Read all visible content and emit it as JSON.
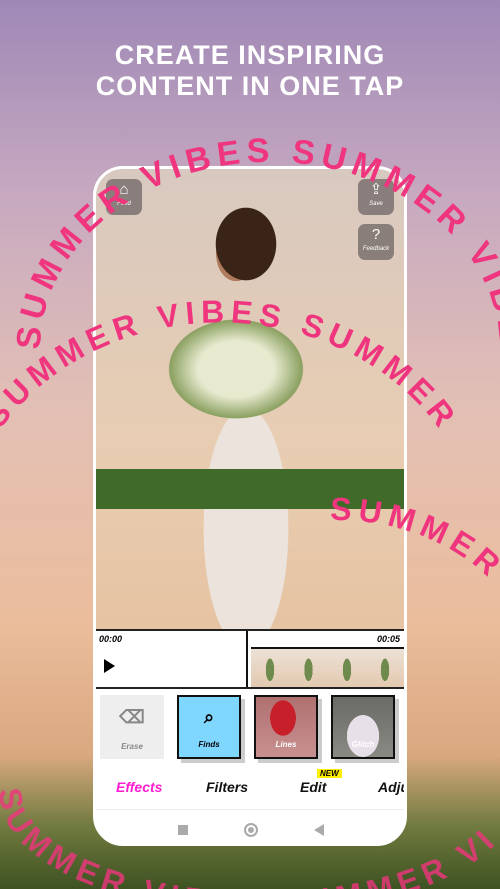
{
  "headline": {
    "line1": "CREATE INSPIRING",
    "line2": "CONTENT IN ONE TAP"
  },
  "overlay_text": "SUMMER VIBES SUMMER VIBES SUMMER VIBES",
  "colors": {
    "accent": "#ff1fd0",
    "overlay": "#f0357f",
    "finds_bg": "#7fd6ff",
    "new_badge": "#ffee00"
  },
  "top_buttons": {
    "feed": "Feed",
    "save": "Save",
    "feedback": "Feedback"
  },
  "timeline": {
    "start": "00:00",
    "end": "00:05"
  },
  "effects": [
    {
      "label": "Erase"
    },
    {
      "label": "Finds"
    },
    {
      "label": "Lines"
    },
    {
      "label": "Glitch"
    }
  ],
  "tabs": [
    {
      "label": "Effects",
      "active": true
    },
    {
      "label": "Filters"
    },
    {
      "label": "Edit",
      "badge": "NEW"
    },
    {
      "label": "Adju"
    }
  ]
}
